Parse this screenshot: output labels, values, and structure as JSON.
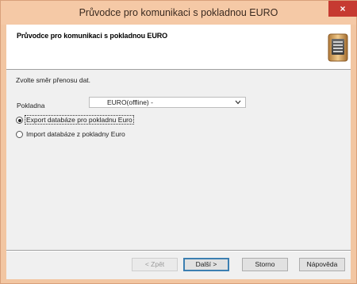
{
  "window": {
    "title": "Průvodce pro komunikaci s pokladnou EURO",
    "close_glyph": "×"
  },
  "header": {
    "title": "Průvodce pro komunikaci s pokladnou EURO",
    "icon": "cash-register-icon"
  },
  "form": {
    "prompt": "Zvolte směr přenosu dat.",
    "pokladna_label": "Pokladna",
    "pokladna_value": "EURO(offline) -",
    "options": [
      {
        "label": "Export databáze pro pokladnu Euro",
        "checked": true
      },
      {
        "label": "Import databáze z pokladny Euro",
        "checked": false
      }
    ]
  },
  "buttons": {
    "back": "< Zpět",
    "next": "Další >",
    "cancel": "Storno",
    "help": "Nápověda"
  },
  "colors": {
    "titlebar": "#f5c9a6",
    "close": "#c63a31",
    "default_button_border": "#3c7fb1"
  }
}
